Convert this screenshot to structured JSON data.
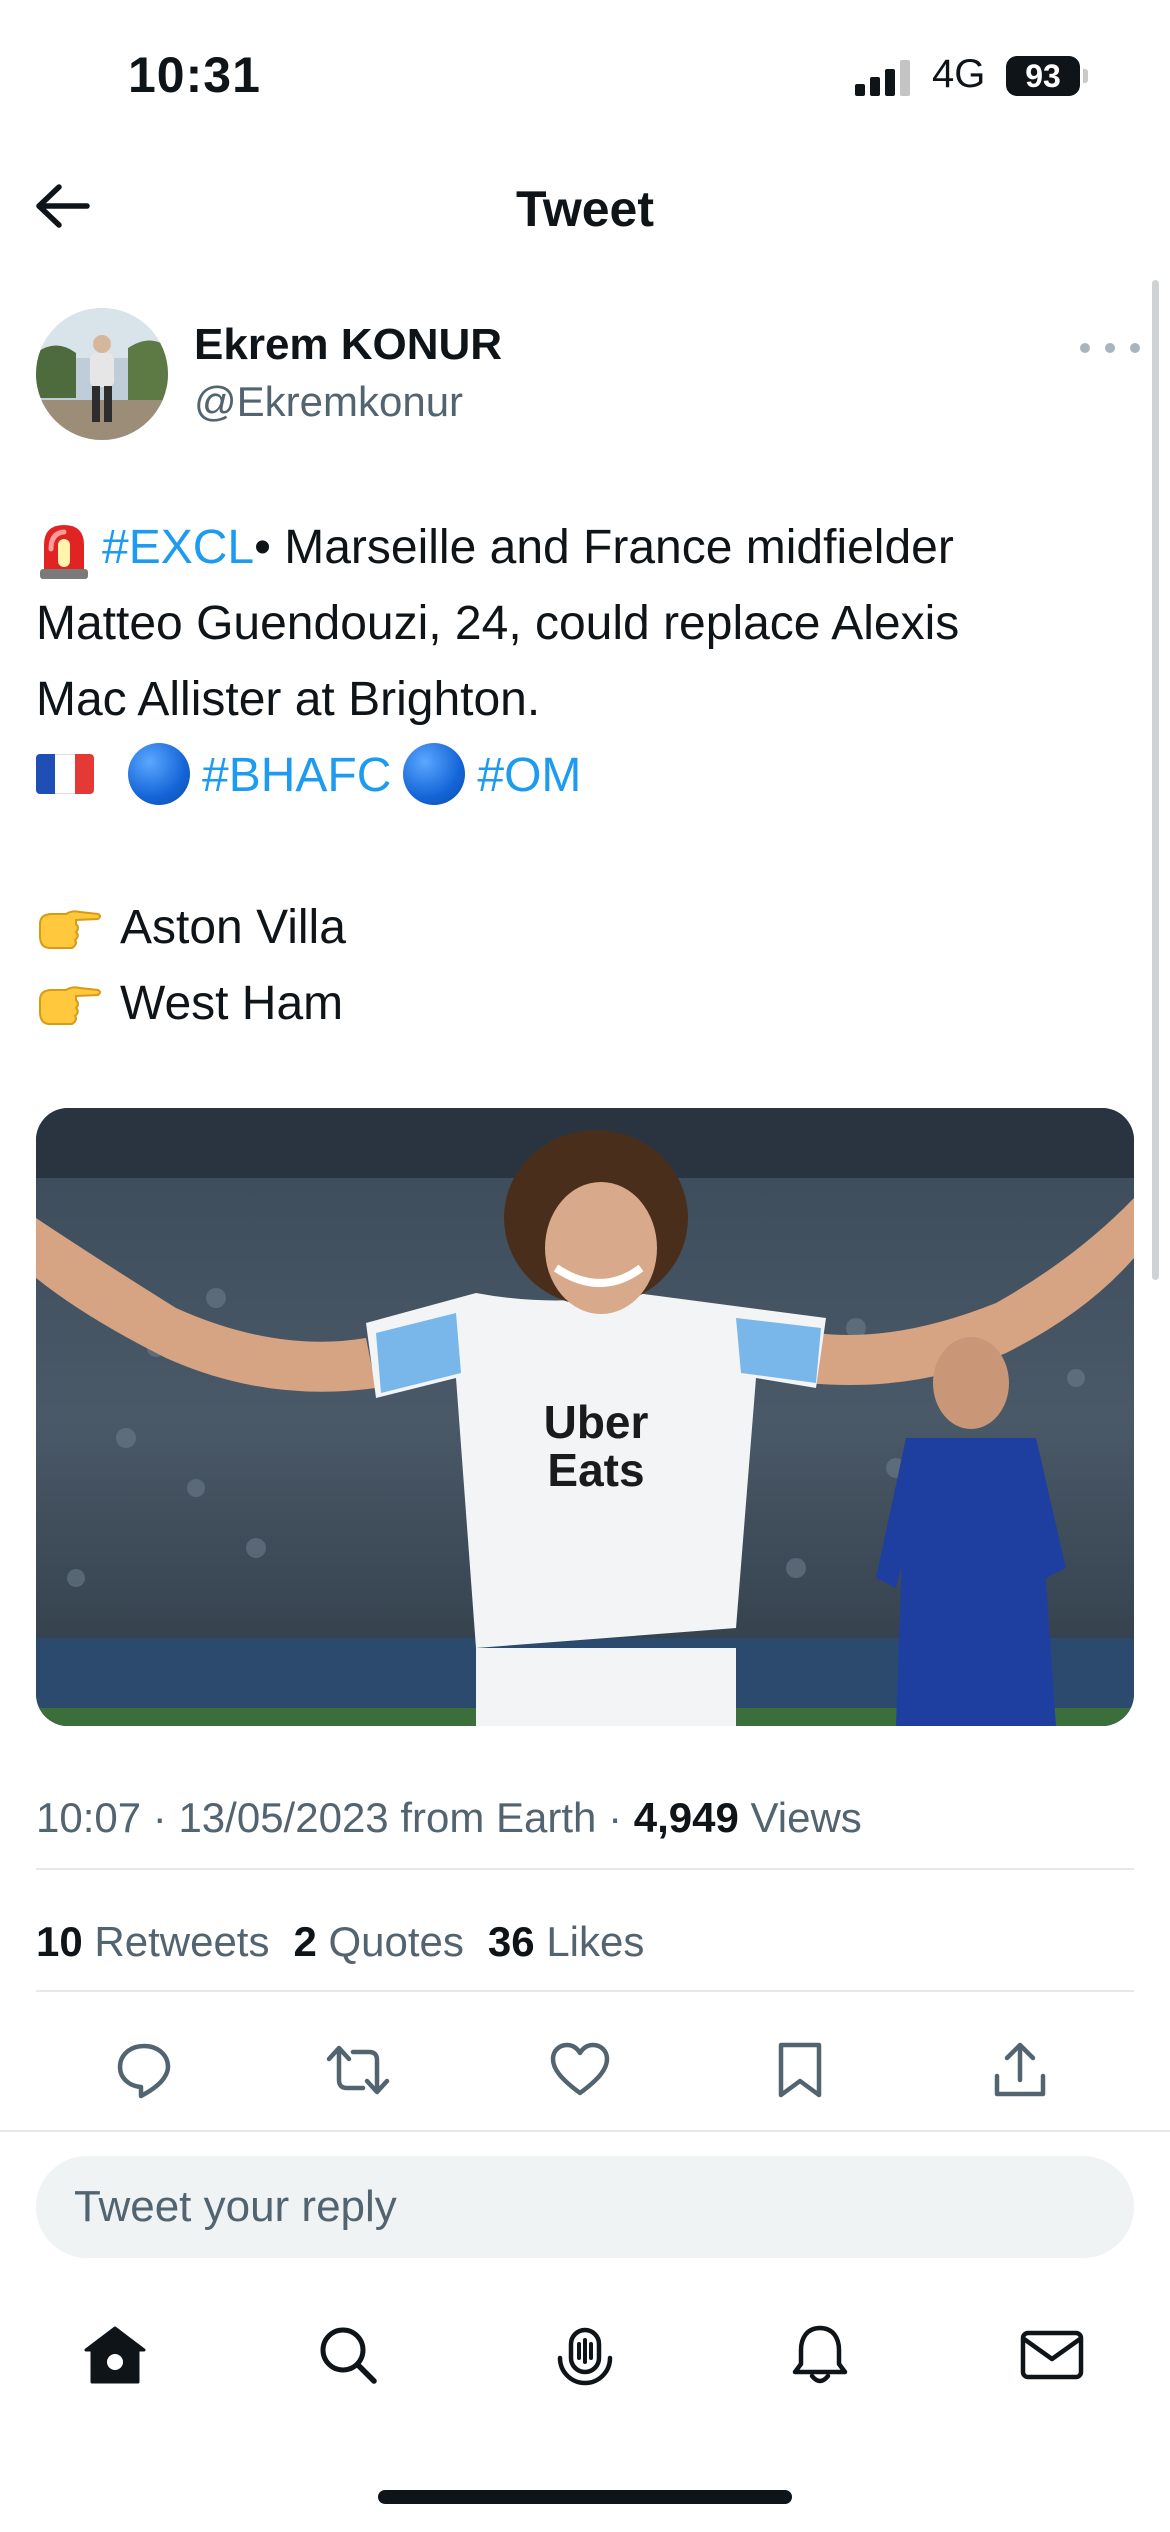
{
  "status_bar": {
    "time": "10:31",
    "network": "4G",
    "battery": "93"
  },
  "header": {
    "title": "Tweet"
  },
  "tweet": {
    "author_name": "Ekrem KONUR",
    "author_handle": "@Ekremkonur",
    "lines": {
      "l1_hashtag": "#EXCL",
      "l1_text": "• Marseille and France midfielder",
      "l2_text": "Matteo Guendouzi, 24, could replace Alexis",
      "l3_text": "Mac Allister at Brighton.",
      "l4_hashtag1": "#BHAFC",
      "l4_hashtag2": "#OM",
      "l5_text": "Aston Villa",
      "l6_text": "West Ham"
    },
    "media": {
      "shirt_sponsor_line1": "Uber",
      "shirt_sponsor_line2": "Eats"
    },
    "meta": {
      "time": "10:07",
      "sep1": "·",
      "date": "13/05/2023",
      "source": "from Earth",
      "sep2": "·",
      "views_count": "4,949",
      "views_label": "Views"
    },
    "stats": {
      "retweets_count": "10",
      "retweets_label": "Retweets",
      "quotes_count": "2",
      "quotes_label": "Quotes",
      "likes_count": "36",
      "likes_label": "Likes"
    }
  },
  "reply": {
    "placeholder": "Tweet your reply"
  },
  "icons": {
    "back": "arrow-left-icon",
    "more": "more-horizontal-icon",
    "reply": "comment-icon",
    "retweet": "retweet-icon",
    "like": "heart-icon",
    "bookmark": "bookmark-icon",
    "share": "share-icon",
    "tab_home": "home-icon",
    "tab_search": "search-icon",
    "tab_spaces": "spaces-icon",
    "tab_notifications": "bell-icon",
    "tab_messages": "mail-icon"
  },
  "colors": {
    "accent": "#1d9bf0",
    "text": "#0f1419",
    "secondary": "#536471"
  }
}
